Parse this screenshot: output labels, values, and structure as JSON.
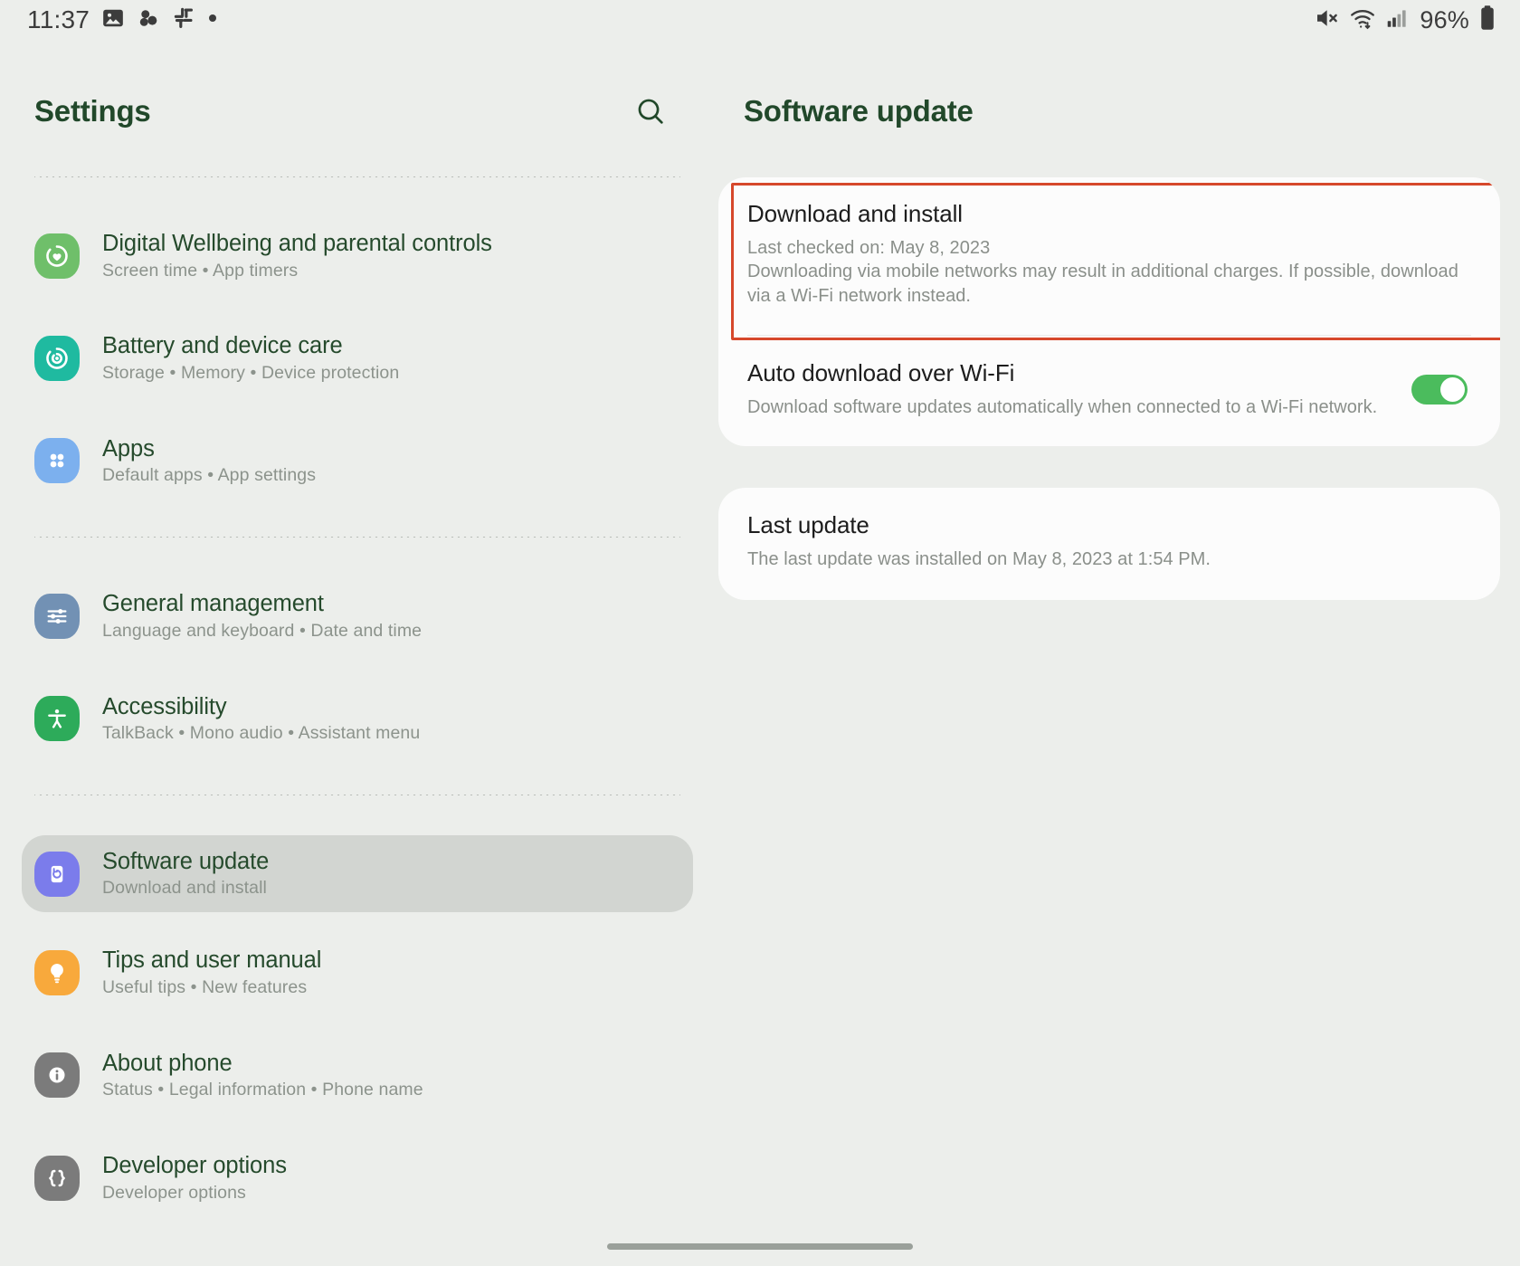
{
  "status_bar": {
    "clock": "11:37",
    "battery_percent": "96%",
    "left_icons": [
      "image-icon",
      "google-photos-icon",
      "slack-icon",
      "dot-icon"
    ],
    "right_icons": [
      "mute-icon",
      "wifi-icon",
      "cellular-signal-icon",
      "battery-icon"
    ]
  },
  "sidebar": {
    "title": "Settings",
    "search_icon": "search-icon",
    "groups": [
      {
        "items": [
          {
            "name": "digital-wellbeing",
            "title": "Digital Wellbeing and parental controls",
            "subtitle": "Screen time  •  App timers",
            "icon": "wellbeing-icon",
            "icon_color": "#6fbf6a",
            "selected": false
          },
          {
            "name": "battery-device-care",
            "title": "Battery and device care",
            "subtitle": "Storage  •  Memory  •  Device protection",
            "icon": "battery-care-icon",
            "icon_color": "#1fbaa0",
            "selected": false
          },
          {
            "name": "apps",
            "title": "Apps",
            "subtitle": "Default apps  •  App settings",
            "icon": "apps-grid-icon",
            "icon_color": "#7cb0ee",
            "selected": false
          }
        ]
      },
      {
        "items": [
          {
            "name": "general-management",
            "title": "General management",
            "subtitle": "Language and keyboard  •  Date and time",
            "icon": "sliders-icon",
            "icon_color": "#7291b4",
            "selected": false
          },
          {
            "name": "accessibility",
            "title": "Accessibility",
            "subtitle": "TalkBack  •  Mono audio  •  Assistant menu",
            "icon": "accessibility-person-icon",
            "icon_color": "#2dab5a",
            "selected": false
          }
        ]
      },
      {
        "items": [
          {
            "name": "software-update",
            "title": "Software update",
            "subtitle": "Download and install",
            "icon": "software-update-icon",
            "icon_color": "#7b7ceb",
            "selected": true
          },
          {
            "name": "tips-and-user-manual",
            "title": "Tips and user manual",
            "subtitle": "Useful tips  •  New features",
            "icon": "lightbulb-icon",
            "icon_color": "#f8a93c",
            "selected": false
          },
          {
            "name": "about-phone",
            "title": "About phone",
            "subtitle": "Status  •  Legal information  •  Phone name",
            "icon": "info-icon",
            "icon_color": "#7b7b7b",
            "selected": false
          },
          {
            "name": "developer-options",
            "title": "Developer options",
            "subtitle": "Developer options",
            "icon": "braces-icon",
            "icon_color": "#7b7b7b",
            "selected": false
          }
        ]
      }
    ]
  },
  "detail": {
    "title": "Software update",
    "download_and_install": {
      "title": "Download and install",
      "last_checked": "Last checked on: May 8, 2023",
      "note": "Downloading via mobile networks may result in additional charges. If possible, download via a Wi-Fi network instead.",
      "highlight_color": "#d6482b"
    },
    "auto_download": {
      "title": "Auto download over Wi-Fi",
      "subtitle": "Download software updates automatically when connected to a Wi-Fi network.",
      "toggle_on": true,
      "toggle_color": "#4bbc5d"
    },
    "last_update": {
      "title": "Last update",
      "subtitle": "The last update was installed on May 8, 2023 at 1:54 PM."
    }
  }
}
